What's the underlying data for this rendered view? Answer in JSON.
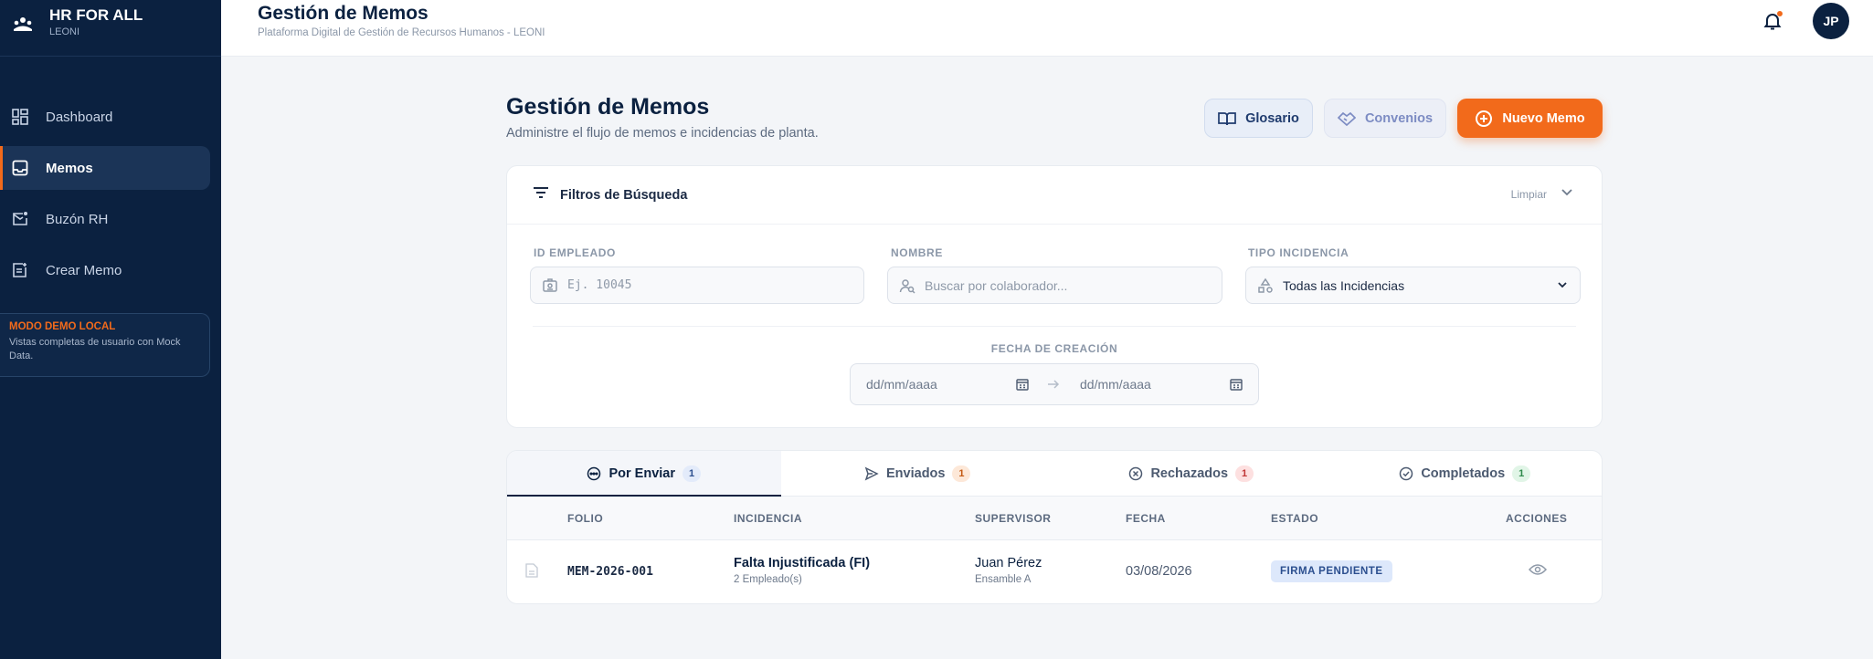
{
  "brand": {
    "title": "HR FOR ALL",
    "subtitle": "LEONI",
    "icon": "logo-icon"
  },
  "sidebar": {
    "items": [
      {
        "label": "Dashboard",
        "icon": "dashboard-icon"
      },
      {
        "label": "Memos",
        "icon": "inbox-icon",
        "active": true
      },
      {
        "label": "Buzón RH",
        "icon": "mail-icon"
      },
      {
        "label": "Crear Memo",
        "icon": "create-memo-icon"
      }
    ],
    "demo": {
      "title": "MODO DEMO LOCAL",
      "text": "Vistas completas de usuario con Mock Data."
    }
  },
  "header": {
    "title": "Gestión de Memos",
    "subtitle": "Plataforma Digital de Gestión de Recursos Humanos - LEONI",
    "avatar": "JP"
  },
  "page": {
    "title": "Gestión de Memos",
    "subtitle": "Administre el flujo de memos e incidencias de planta.",
    "buttons": {
      "glosario": "Glosario",
      "convenios": "Convenios",
      "nuevo": "Nuevo Memo"
    }
  },
  "filters": {
    "title": "Filtros de Búsqueda",
    "clear": "Limpiar",
    "id_label": "ID EMPLEADO",
    "id_placeholder": "Ej. 10045",
    "name_label": "NOMBRE",
    "name_placeholder": "Buscar por colaborador...",
    "type_label": "TIPO INCIDENCIA",
    "type_value": "Todas las Incidencias",
    "date_label": "FECHA DE CREACIÓN",
    "date_from": "dd/mm/aaaa",
    "date_to": "dd/mm/aaaa"
  },
  "tabs": [
    {
      "label": "Por Enviar",
      "count": "1"
    },
    {
      "label": "Enviados",
      "count": "1"
    },
    {
      "label": "Rechazados",
      "count": "1"
    },
    {
      "label": "Completados",
      "count": "1"
    }
  ],
  "table": {
    "columns": [
      "FOLIO",
      "INCIDENCIA",
      "SUPERVISOR",
      "FECHA",
      "ESTADO",
      "ACCIONES"
    ],
    "rows": [
      {
        "folio": "MEM-2026-001",
        "incidencia": "Falta Injustificada (FI)",
        "empleados": "2 Empleado(s)",
        "supervisor": "Juan Pérez",
        "area": "Ensamble A",
        "fecha": "03/08/2026",
        "estado": "FIRMA PENDIENTE"
      }
    ]
  },
  "colors": {
    "sidebar": "#0b2140",
    "accent": "#f26a1b",
    "background": "#f3f5f8"
  }
}
